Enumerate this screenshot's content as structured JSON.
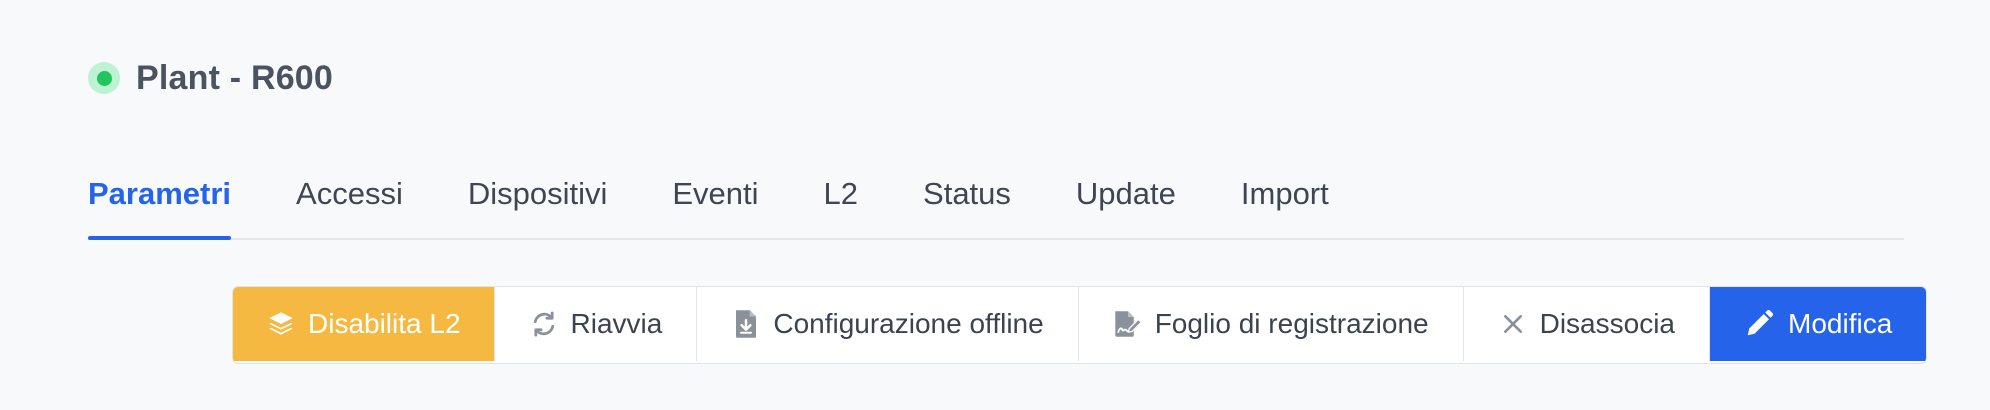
{
  "header": {
    "title": "Plant - R600",
    "status_color": "#22c55e"
  },
  "tabs": [
    {
      "label": "Parametri",
      "active": true
    },
    {
      "label": "Accessi"
    },
    {
      "label": "Dispositivi"
    },
    {
      "label": "Eventi"
    },
    {
      "label": "L2"
    },
    {
      "label": "Status"
    },
    {
      "label": "Update"
    },
    {
      "label": "Import"
    }
  ],
  "actions": {
    "disable_l2": {
      "label": "Disabilita L2",
      "icon": "layers-icon",
      "color": "#f5b942"
    },
    "restart": {
      "label": "Riavvia",
      "icon": "refresh-icon"
    },
    "offline_config": {
      "label": "Configurazione offline",
      "icon": "file-download-icon"
    },
    "registration_sheet": {
      "label": "Foglio di registrazione",
      "icon": "file-signature-icon"
    },
    "disassociate": {
      "label": "Disassocia",
      "icon": "close-icon"
    },
    "edit": {
      "label": "Modifica",
      "icon": "pencil-icon",
      "color": "#2563eb"
    }
  },
  "accent_color": "#2563eb"
}
